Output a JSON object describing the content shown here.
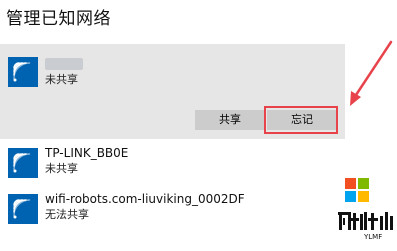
{
  "page": {
    "title": "管理已知网络"
  },
  "networks": [
    {
      "name": "",
      "status": "未共享",
      "selected": true,
      "icon": "wifi-icon",
      "actions": {
        "share_label": "共享",
        "forget_label": "忘记"
      }
    },
    {
      "name": "TP-LINK_BB0E",
      "status": "未共享",
      "selected": false,
      "icon": "wifi-icon"
    },
    {
      "name": "wifi-robots.com-liuviking_0002DF",
      "status": "无法共享",
      "selected": false,
      "icon": "wifi-icon"
    }
  ],
  "annotation": {
    "highlight_color": "#e8434b",
    "arrow_color": "#e8434b"
  },
  "watermark": {
    "logo_text": "雨林木风",
    "sub_text": "YLMF",
    "colors": [
      "#f25022",
      "#7fba00",
      "#00a4ef",
      "#ffb900"
    ]
  },
  "colors": {
    "accent": "#0063b1",
    "selected_background": "#e6e6e6",
    "button_background": "#cccccc"
  }
}
